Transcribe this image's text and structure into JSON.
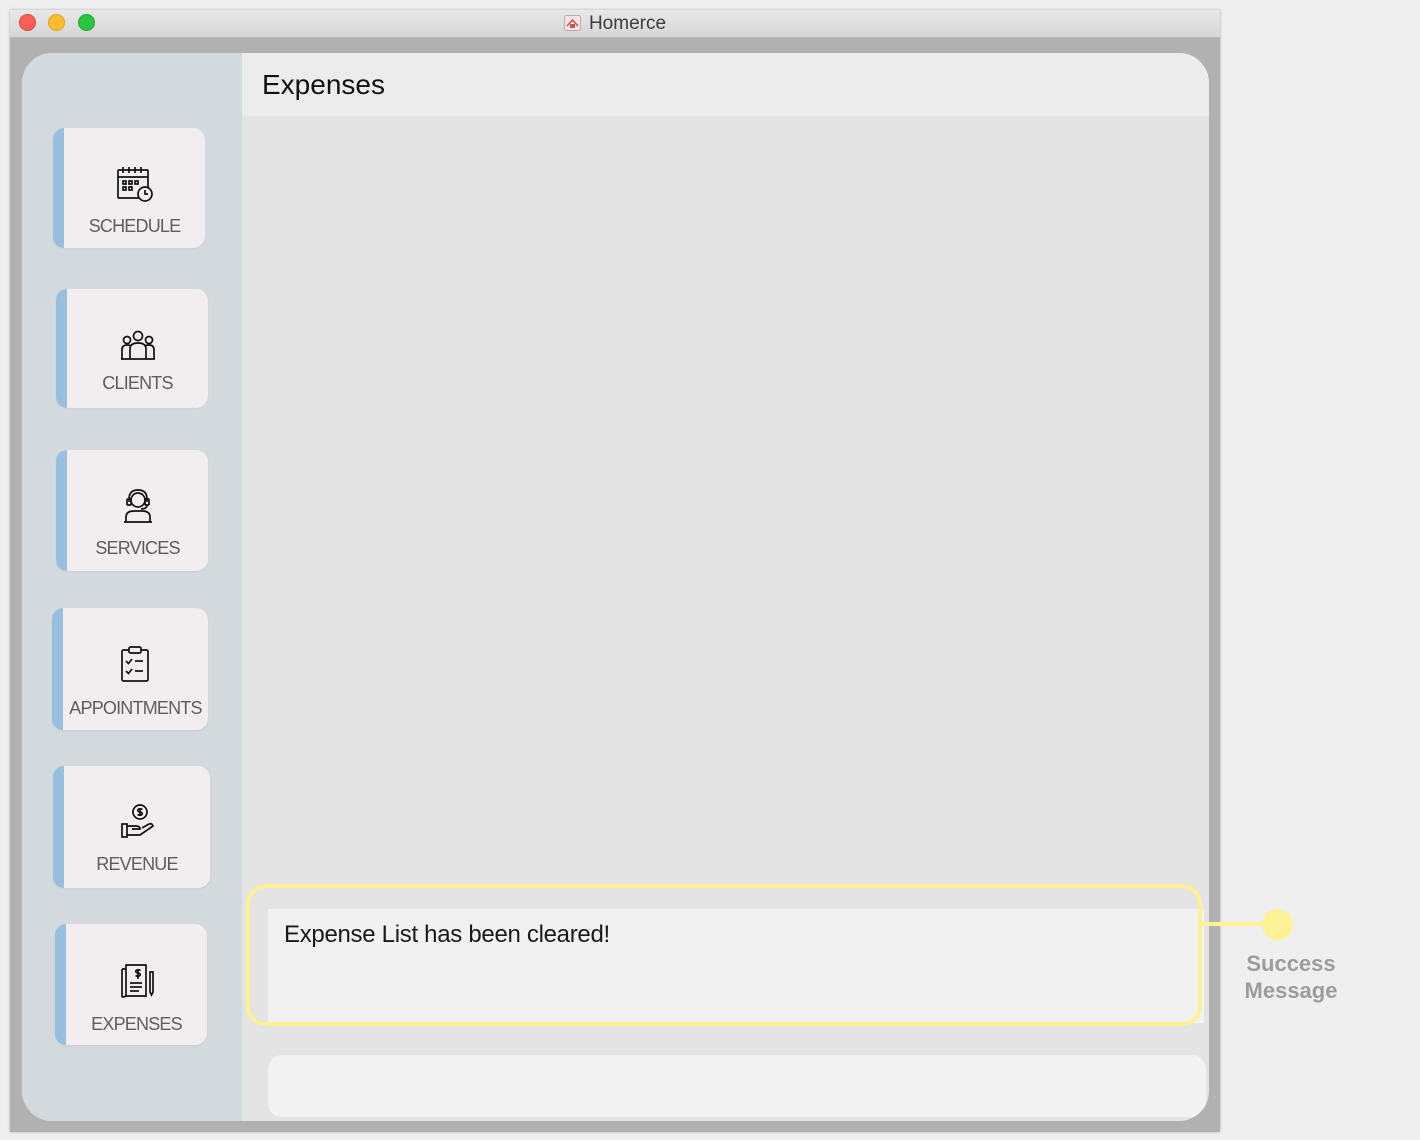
{
  "window": {
    "title": "Homerce"
  },
  "header": {
    "title": "Expenses"
  },
  "sidebar": {
    "items": [
      {
        "label": "SCHEDULE",
        "icon": "calendar-clock-icon"
      },
      {
        "label": "CLIENTS",
        "icon": "people-group-icon"
      },
      {
        "label": "SERVICES",
        "icon": "service-agent-icon"
      },
      {
        "label": "APPOINTMENTS",
        "icon": "clipboard-checklist-icon"
      },
      {
        "label": "REVENUE",
        "icon": "hand-coin-icon"
      },
      {
        "label": "EXPENSES",
        "icon": "expense-report-icon"
      }
    ]
  },
  "result": {
    "message": "Expense List has been cleared!"
  },
  "command": {
    "value": ""
  },
  "annotation": {
    "line1": "Success",
    "line2": "Message",
    "color": "#fcf193"
  },
  "colors": {
    "accent": "#99bfe0",
    "sidebar": "#d2dade",
    "traffic_close": "#fd5f57",
    "traffic_min": "#febc2e",
    "traffic_max": "#29c740"
  }
}
